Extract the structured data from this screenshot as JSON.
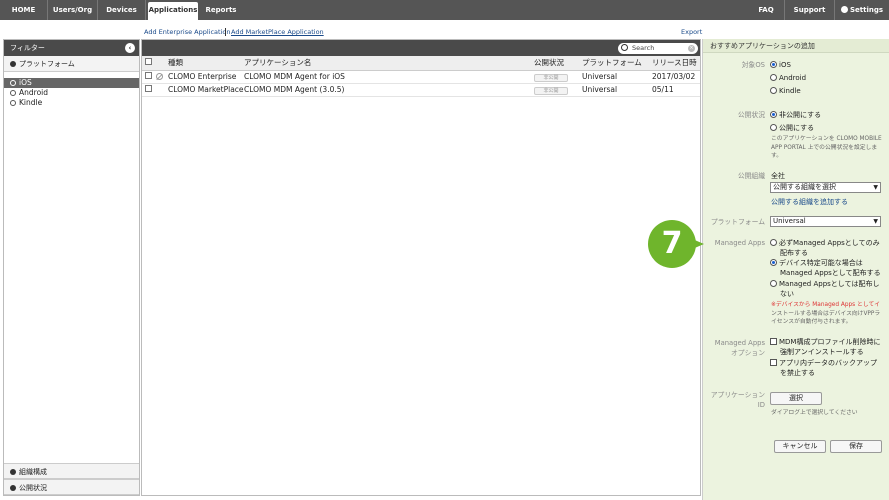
{
  "nav": {
    "items": [
      "HOME",
      "Users/Org",
      "Devices",
      "Applications",
      "Reports"
    ],
    "right": [
      "FAQ",
      "Support",
      "Settings"
    ]
  },
  "links": {
    "add_enterprise": "Add Enterprise Application",
    "add_marketplace": "Add MarketPlace Application",
    "export": "Export"
  },
  "filter": {
    "title": "フィルター",
    "platform_group": "プラットフォーム",
    "platforms": [
      "iOS",
      "Android",
      "Kindle"
    ],
    "bottom_groups": [
      "組織構成",
      "公開状況"
    ]
  },
  "table": {
    "search_placeholder": "Search",
    "columns": [
      "種類",
      "アプリケーション名",
      "公開状況",
      "プラットフォーム",
      "リリース日時"
    ],
    "rows": [
      {
        "type": "CLOMO Enterprise",
        "name": "CLOMO MDM Agent for iOS",
        "status": "非公開",
        "platform": "Universal",
        "date": "2017/03/02"
      },
      {
        "type": "CLOMO MarketPlace",
        "name": "CLOMO MDM Agent (3.0.5)",
        "status": "非公開",
        "platform": "Universal",
        "date": "05/11"
      }
    ]
  },
  "panel": {
    "title": "おすすめアプリケーションの追加",
    "os_label": "対象OS",
    "os_options": [
      "iOS",
      "Android",
      "Kindle"
    ],
    "publish_label": "公開状況",
    "publish_options": [
      "非公開にする",
      "公開にする"
    ],
    "publish_note_1": "このアプリケーションを CLOMO MOBILE",
    "publish_note_2": "APP PORTAL 上での公開状況を設定しま",
    "publish_note_3": "す。",
    "org_label": "公開組織",
    "org_value": "全社",
    "org_select": "公開する組織を選択",
    "org_add": "公開する組織を追加する",
    "platform_label": "プラットフォーム",
    "platform_value": "Universal",
    "managed_label": "Managed Apps",
    "managed_opt1_a": "必ずManaged Appsとしてのみ",
    "managed_opt1_b": "配布する",
    "managed_opt2_a": "デバイス特定可能な場合は",
    "managed_opt2_b": "Managed Appsとして配布する",
    "managed_opt3_a": "Managed Appsとしては配布し",
    "managed_opt3_b": "ない",
    "managed_note_1": "※デバイスから Managed Apps としてイ",
    "managed_note_2": "ンストールする場合はデバイス向けVPPラ",
    "managed_note_3": "イセンスが自動付与されます。",
    "managed_opt_label_1": "Managed Apps",
    "managed_opt_label_2": "オプション",
    "chk1_a": "MDM構成プロファイル削除時に",
    "chk1_b": "強制アンインストールする",
    "chk2_a": "アプリ内データのバックアップ",
    "chk2_b": "を禁止する",
    "appid_label_1": "アプリケーション",
    "appid_label_2": "ID",
    "select_button": "選択",
    "appid_note": "ダイアログ上で選択してください",
    "cancel": "キャンセル",
    "save": "保存"
  },
  "step_number": "7",
  "colors": {
    "accent_green": "#6fb52c",
    "nav_bg": "#555555",
    "panel_bg": "#ecf3df"
  }
}
